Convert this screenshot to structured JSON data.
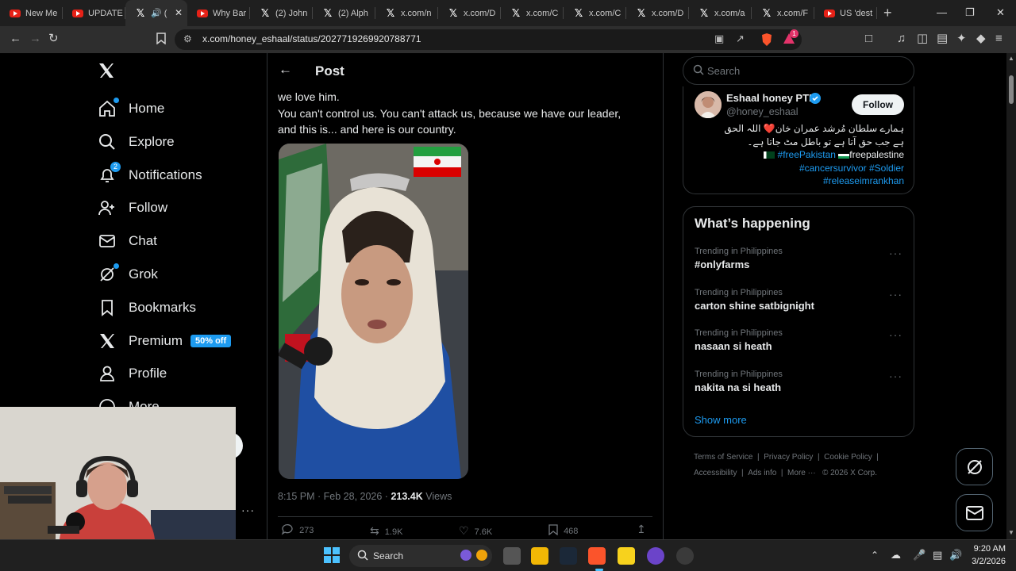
{
  "browser": {
    "tabs": [
      {
        "label": "New Me",
        "icon": "youtube-icon"
      },
      {
        "label": "UPDATE",
        "icon": "youtube-icon"
      },
      {
        "label": "(",
        "icon": "x-icon",
        "active": true
      },
      {
        "label": "Why Bar",
        "icon": "youtube-icon"
      },
      {
        "label": "(2) John",
        "icon": "x-icon"
      },
      {
        "label": "(2) Alph",
        "icon": "x-icon"
      },
      {
        "label": "x.com/n",
        "icon": "x-icon"
      },
      {
        "label": "x.com/D",
        "icon": "x-icon"
      },
      {
        "label": "x.com/C",
        "icon": "x-icon"
      },
      {
        "label": "x.com/C",
        "icon": "x-icon"
      },
      {
        "label": "x.com/D",
        "icon": "x-icon"
      },
      {
        "label": "x.com/a",
        "icon": "x-icon"
      },
      {
        "label": "x.com/F",
        "icon": "x-icon"
      },
      {
        "label": "US 'dest",
        "icon": "youtube-icon"
      }
    ],
    "url": "x.com/honey_eshaal/status/2027719269920788771",
    "shields_count": "1"
  },
  "nav": {
    "items": [
      {
        "label": "Home",
        "icon": "home-icon"
      },
      {
        "label": "Explore",
        "icon": "search-icon"
      },
      {
        "label": "Notifications",
        "icon": "bell-icon",
        "badge": "2"
      },
      {
        "label": "Follow",
        "icon": "add-person-icon"
      },
      {
        "label": "Chat",
        "icon": "mail-icon"
      },
      {
        "label": "Grok",
        "icon": "grok-icon"
      },
      {
        "label": "Bookmarks",
        "icon": "bookmark-icon"
      },
      {
        "label": "Premium",
        "icon": "x-logo-icon",
        "badge": "50% off"
      },
      {
        "label": "Profile",
        "icon": "person-icon"
      },
      {
        "label": "More",
        "icon": "more-circle-icon"
      }
    ]
  },
  "post": {
    "header": "Post",
    "text_lines": [
      "we love him.",
      "You can't control us. You can't attack us, because we have our leader,",
      "and this is... and here is our country."
    ],
    "time": "8:15 PM · Feb 28, 2026 · ",
    "views_count": "213.4K",
    "views_label": " Views",
    "replies": "273",
    "reposts": "1.9K",
    "likes": "7.6K",
    "bookmarks": "468"
  },
  "sidebar": {
    "search_placeholder": "Search",
    "profile": {
      "name": "Eshaal honey PTI",
      "handle": "@honey_eshaal",
      "follow_label": "Follow",
      "bio_line1": "ہمارے سلطان مُرشد عمران خان❤️ اللہ الحق",
      "bio_line2": "ہے جب حق آتا ہے تو باطل مٹ جاتا ہے۔",
      "bio_line3_tag1": "#freePakistan",
      "bio_line3_text": "freepalestine",
      "bio_line4": "#cancersurvivor #Soldier",
      "bio_line5": "#releaseimrankhan"
    },
    "happening_title": "What’s happening",
    "trends": [
      {
        "context": "Trending in Philippines",
        "title": "#onlyfarms"
      },
      {
        "context": "Trending in Philippines",
        "title": "carton shine satbignight"
      },
      {
        "context": "Trending in Philippines",
        "title": "nasaan si heath"
      },
      {
        "context": "Trending in Philippines",
        "title": "nakita na si heath"
      }
    ],
    "show_more": "Show more",
    "footer_links": [
      "Terms of Service",
      "Privacy Policy",
      "Cookie Policy",
      "Accessibility",
      "Ads info",
      "More ···",
      "© 2026 X Corp."
    ]
  },
  "taskbar": {
    "search_label": "Search",
    "time": "9:20 AM",
    "date": "3/2/2026"
  },
  "colors": {
    "accent": "#1d9bf0",
    "text": "#e7e9ea",
    "muted": "#71767b",
    "border": "#2f3336"
  }
}
